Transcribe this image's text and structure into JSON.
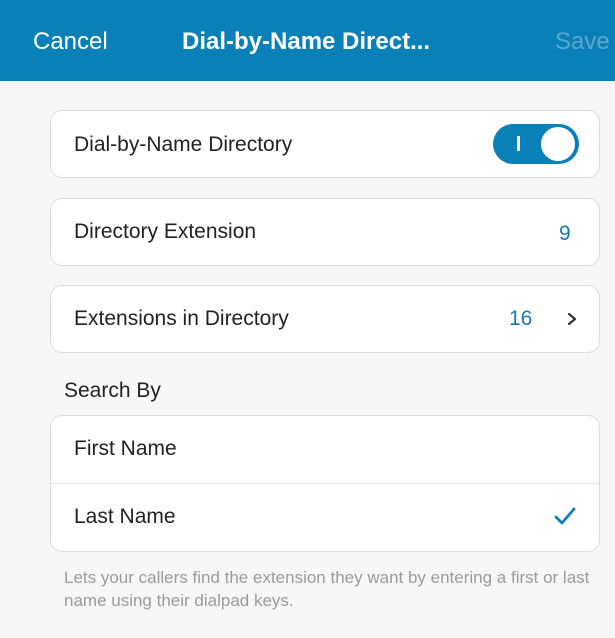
{
  "header": {
    "cancel_label": "Cancel",
    "title": "Dial-by-Name Direct...",
    "save_label": "Save"
  },
  "settings": {
    "dial_by_name": {
      "label": "Dial-by-Name Directory",
      "enabled": true,
      "toggle_on_glyph": "I"
    },
    "directory_extension": {
      "label": "Directory Extension",
      "value": "9"
    },
    "extensions_in_directory": {
      "label": "Extensions in Directory",
      "value": "16"
    }
  },
  "search_by": {
    "section_label": "Search By",
    "options": [
      {
        "label": "First Name",
        "selected": false
      },
      {
        "label": "Last Name",
        "selected": true
      }
    ]
  },
  "footnote": "Lets your callers find the extension they want by entering a first or last name using their dialpad keys.",
  "colors": {
    "accent": "#0a80b8",
    "value_text": "#1679b5",
    "save_disabled": "#5aa6cf",
    "footnote_text": "#9a9a9a"
  },
  "icons": {
    "chevron": "chevron-right-icon",
    "check": "checkmark-icon"
  }
}
